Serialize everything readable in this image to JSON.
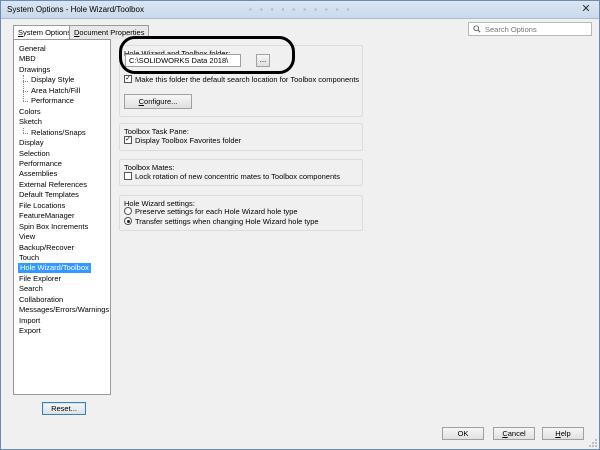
{
  "window": {
    "title": "System Options - Hole Wizard/Toolbox",
    "close_glyph": "✕",
    "ghost_toolbar": "▪▪▪▪▪▪▪▪▪▪"
  },
  "tabs": [
    {
      "label": "System Options",
      "accel": "S",
      "rest": "ystem Options",
      "active": true
    },
    {
      "label": "Document Properties",
      "accel": "D",
      "rest": "ocument Properties",
      "active": false
    }
  ],
  "search": {
    "placeholder": "Search Options",
    "icon": "search-icon"
  },
  "tree": [
    {
      "label": "General",
      "level": 0
    },
    {
      "label": "MBD",
      "level": 0
    },
    {
      "label": "Drawings",
      "level": 0
    },
    {
      "label": "Display Style",
      "level": 1
    },
    {
      "label": "Area Hatch/Fill",
      "level": 1
    },
    {
      "label": "Performance",
      "level": 1
    },
    {
      "label": "Colors",
      "level": 0
    },
    {
      "label": "Sketch",
      "level": 0
    },
    {
      "label": "Relations/Snaps",
      "level": 1
    },
    {
      "label": "Display",
      "level": 0
    },
    {
      "label": "Selection",
      "level": 0
    },
    {
      "label": "Performance",
      "level": 0
    },
    {
      "label": "Assemblies",
      "level": 0
    },
    {
      "label": "External References",
      "level": 0
    },
    {
      "label": "Default Templates",
      "level": 0
    },
    {
      "label": "File Locations",
      "level": 0
    },
    {
      "label": "FeatureManager",
      "level": 0
    },
    {
      "label": "Spin Box Increments",
      "level": 0
    },
    {
      "label": "View",
      "level": 0
    },
    {
      "label": "Backup/Recover",
      "level": 0
    },
    {
      "label": "Touch",
      "level": 0
    },
    {
      "label": "Hole Wizard/Toolbox",
      "level": 0,
      "selected": true
    },
    {
      "label": "File Explorer",
      "level": 0
    },
    {
      "label": "Search",
      "level": 0
    },
    {
      "label": "Collaboration",
      "level": 0
    },
    {
      "label": "Messages/Errors/Warnings",
      "level": 0
    },
    {
      "label": "Import",
      "level": 0
    },
    {
      "label": "Export",
      "level": 0
    }
  ],
  "reset_label": "Reset...",
  "folder_group": {
    "title": "Hole Wizard and Toolbox folder:",
    "path": "C:\\SOLIDWORKS Data 2018\\",
    "browse_label": "...",
    "default_location_label": "Make this folder the default search location for Toolbox components",
    "default_location_checked": true,
    "configure_accel": "C",
    "configure_rest": "onfigure..."
  },
  "task_pane_group": {
    "title": "Toolbox Task Pane:",
    "favorites_label": "Display Toolbox Favorites folder",
    "favorites_checked": true
  },
  "mates_group": {
    "title": "Toolbox Mates:",
    "lock_label": "Lock rotation of new concentric mates to Toolbox components",
    "lock_checked": false
  },
  "settings_group": {
    "title": "Hole Wizard settings:",
    "options": [
      {
        "label": "Preserve settings for each Hole Wizard hole type",
        "selected": false
      },
      {
        "label": "Transfer settings when changing Hole Wizard hole type",
        "selected": true
      }
    ]
  },
  "buttons": {
    "ok": "OK",
    "cancel_accel": "C",
    "cancel_rest": "ancel",
    "help_accel": "H",
    "help_rest": "elp"
  },
  "check_glyph": "✓"
}
